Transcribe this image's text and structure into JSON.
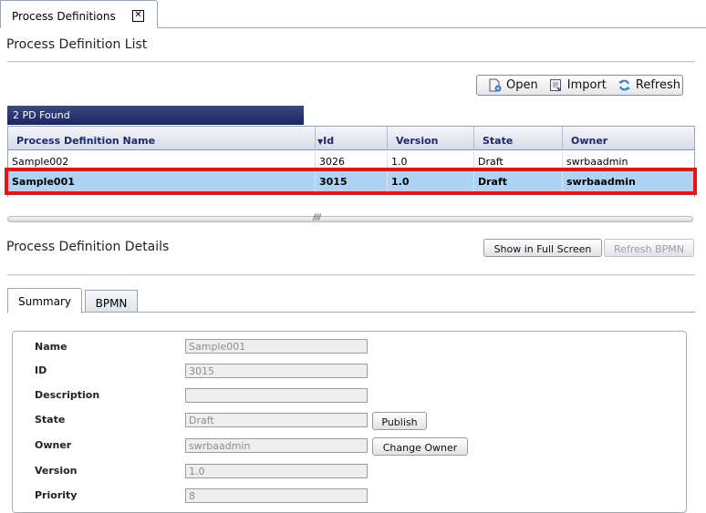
{
  "top_tab": {
    "label": "Process Definitions",
    "close": "✕"
  },
  "list_section": {
    "title": "Process Definition List"
  },
  "toolbar": {
    "open": "Open",
    "import": "Import",
    "refresh": "Refresh"
  },
  "table": {
    "found": "2 PD Found",
    "sort_marker": "▼",
    "columns": [
      "Process Definition Name",
      "Id",
      "Version",
      "State",
      "Owner"
    ],
    "rows": [
      {
        "name": "Sample002",
        "id": "3026",
        "version": "1.0",
        "state": "Draft",
        "owner": "swrbaadmin",
        "selected": false
      },
      {
        "name": "Sample001",
        "id": "3015",
        "version": "1.0",
        "state": "Draft",
        "owner": "swrbaadmin",
        "selected": true
      }
    ]
  },
  "splitter": {
    "grip": "////"
  },
  "details_section": {
    "title": "Process Definition Details",
    "full_screen": "Show in Full Screen",
    "refresh_bpmn": "Refresh BPMN"
  },
  "detail_tabs": {
    "summary": "Summary",
    "bpmn": "BPMN"
  },
  "form": {
    "name": {
      "label": "Name",
      "value": "Sample001"
    },
    "id": {
      "label": "ID",
      "value": "3015"
    },
    "description": {
      "label": "Description",
      "value": ""
    },
    "state": {
      "label": "State",
      "value": "Draft",
      "action": "Publish"
    },
    "owner": {
      "label": "Owner",
      "value": "swrbaadmin",
      "action": "Change Owner"
    },
    "version": {
      "label": "Version",
      "value": "1.0"
    },
    "priority": {
      "label": "Priority",
      "value": "8"
    }
  },
  "colors": {
    "accent": "#1b2660",
    "selection": "#aed3f5",
    "highlight": "#ee1111"
  }
}
